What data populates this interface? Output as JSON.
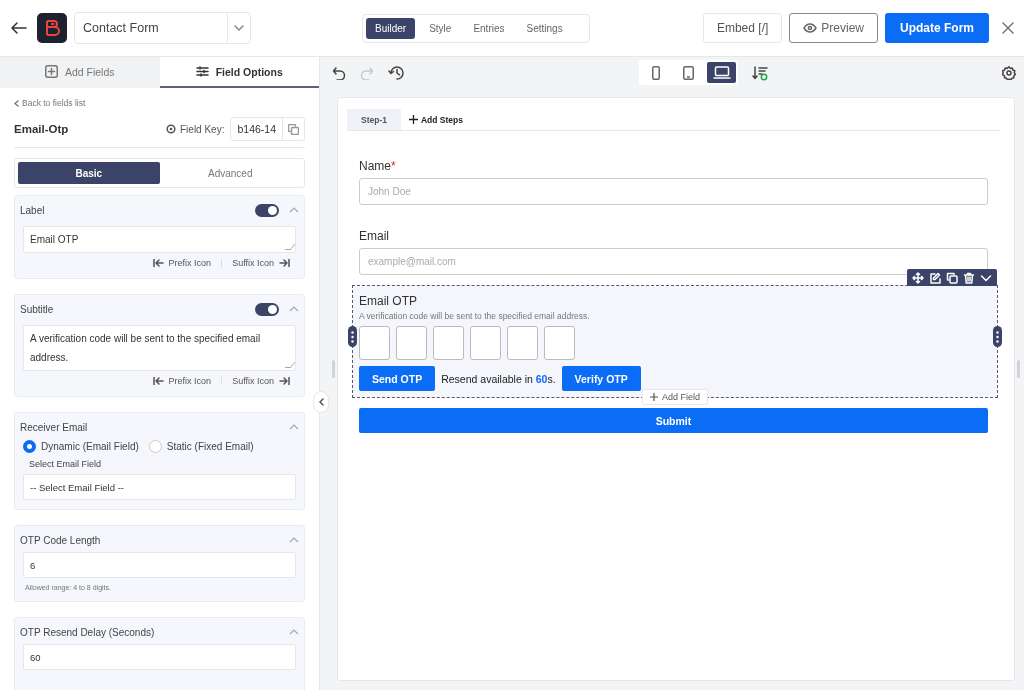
{
  "header": {
    "form_name": "Contact Form",
    "tabs": [
      {
        "label": "Builder",
        "selected": true
      },
      {
        "label": "Style",
        "selected": false
      },
      {
        "label": "Entries",
        "selected": false
      },
      {
        "label": "Settings",
        "selected": false
      }
    ],
    "embed": "Embed [/]",
    "preview": "Preview",
    "update": "Update Form"
  },
  "sidebar": {
    "tabs": [
      {
        "label": "Add Fields",
        "kind": "add",
        "selected": false
      },
      {
        "label": "Field Options",
        "kind": "options",
        "selected": true
      }
    ],
    "back": "Back to fields list",
    "field_title": "Email-Otp",
    "field_key_label": "Field Key:",
    "field_key": "b146-14",
    "mode_tabs": [
      {
        "label": "Basic",
        "selected": true
      },
      {
        "label": "Advanced",
        "selected": false
      }
    ],
    "sections": [
      {
        "kind": "text",
        "title": "Label",
        "on": true,
        "value": "Email OTP",
        "prefix": "Prefix Icon",
        "suffix": "Suffix Icon"
      },
      {
        "kind": "text",
        "title": "Subtitle",
        "on": true,
        "value": "A verification code will be sent to the specified email address.",
        "prefix": "Prefix Icon",
        "suffix": "Suffix Icon"
      },
      {
        "kind": "radio",
        "title": "Receiver Email",
        "options": [
          {
            "label": "Dynamic (Email Field)",
            "selected": true
          },
          {
            "label": "Static (Fixed Email)",
            "selected": false
          }
        ],
        "field_label": "Select Email Field",
        "value": "-- Select Email Field --"
      },
      {
        "kind": "input",
        "title": "OTP Code Length",
        "value": "6",
        "hint": "Allowed range: 4 to 8 digits."
      },
      {
        "kind": "input",
        "title": "OTP Resend Delay (Seconds)",
        "value": "60"
      }
    ]
  },
  "toolbar": {
    "devices": [
      {
        "kind": "mobile",
        "selected": false
      },
      {
        "kind": "tablet",
        "selected": false
      },
      {
        "kind": "desktop",
        "selected": true
      }
    ]
  },
  "canvas": {
    "steps": [
      {
        "label": "Step-1",
        "selected": true
      }
    ],
    "add_steps": "Add Steps",
    "fields": [
      {
        "label": "Name",
        "required_mark": "*",
        "placeholder": "John Doe"
      },
      {
        "label": "Email",
        "placeholder": "example@mail.com"
      }
    ],
    "otp": {
      "label": "Email OTP",
      "subtitle": "A verification code will be sent to the specified email address.",
      "send": "Send OTP",
      "resend": "Resend available in **60**s.",
      "verify": "Verify OTP",
      "add_field": "Add Field"
    },
    "submit": "Submit"
  }
}
